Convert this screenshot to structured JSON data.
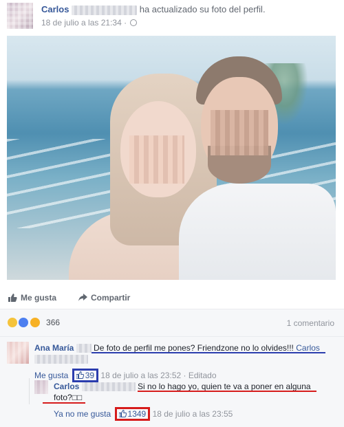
{
  "post": {
    "author": "Carlos",
    "action": "ha actualizado su foto del perfil.",
    "timestamp": "18 de julio a las 21:34 ·",
    "privacy_icon": "globe-icon"
  },
  "actions": {
    "like_label": "Me gusta",
    "share_label": "Compartir"
  },
  "reactions": {
    "icons": [
      "sad-emoji",
      "like-emoji",
      "haha-emoji"
    ],
    "count": "366",
    "comments_label": "1 comentario"
  },
  "comment": {
    "author": "Ana María",
    "text": "De foto de perfil me pones? Friendzone no lo olvides!!!",
    "mention": "Carlos",
    "like_label": "Me gusta",
    "like_count": "39",
    "timestamp": "18 de julio a las 23:52 · Editado"
  },
  "reply": {
    "author": "Carlos",
    "text": "Si no lo hago yo, quien te va a poner en alguna foto?□□",
    "unlike_label": "Ya no me gusta",
    "like_count": "1349",
    "timestamp": "18 de julio a las 23:55"
  },
  "colors": {
    "link": "#365899",
    "highlight_blue": "#2b3dae",
    "highlight_red": "#d61b1b"
  }
}
